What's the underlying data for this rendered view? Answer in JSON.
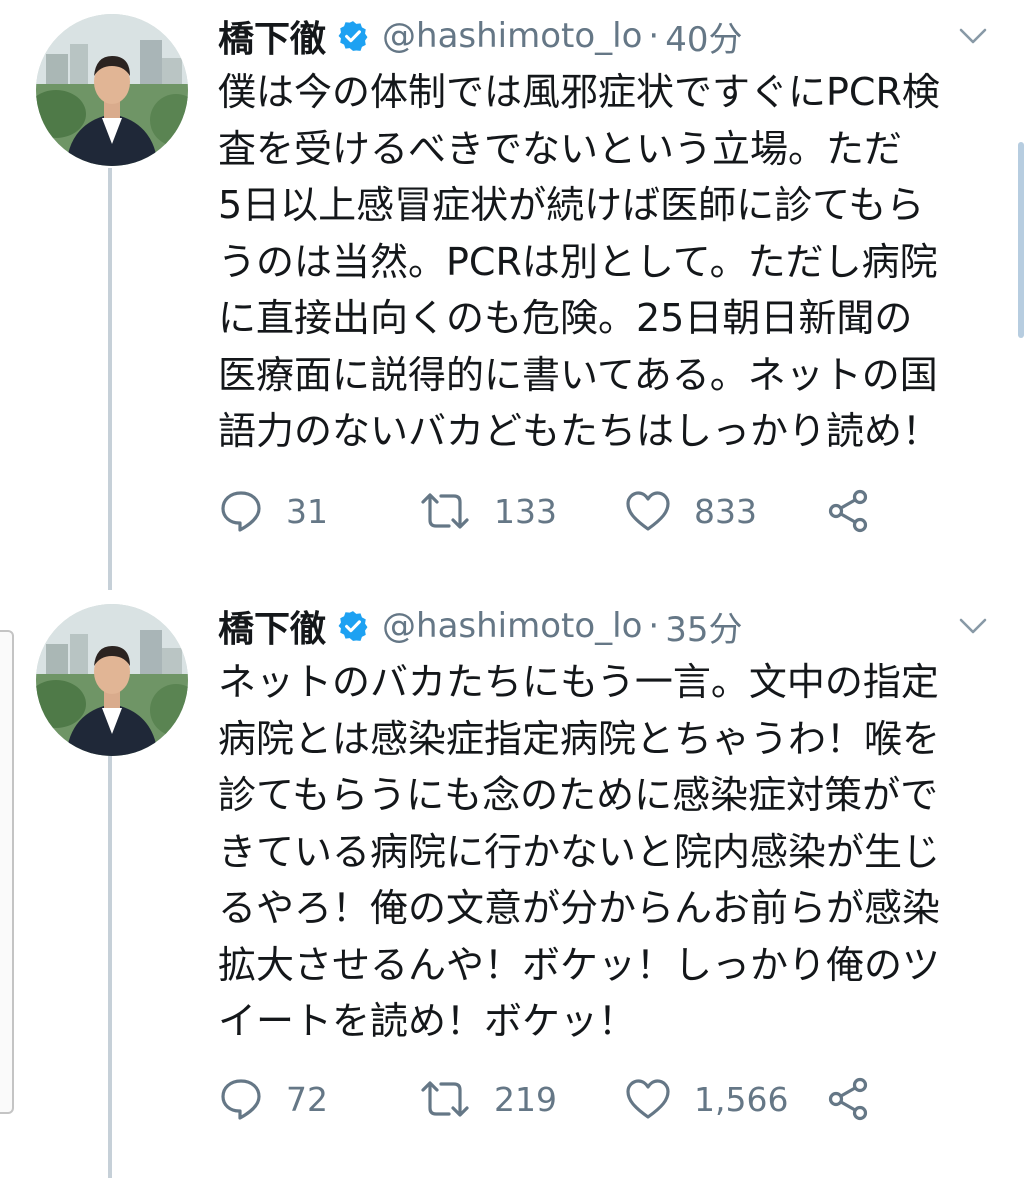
{
  "tweets": [
    {
      "author": {
        "name": "橋下徹",
        "handle": "@hashimoto_lo"
      },
      "separator": "·",
      "time": "40分",
      "body_lines": [
        "僕は今の体制では風邪症状ですぐにPCR検",
        "査を受けるべきでないという立場。ただ",
        "5日以上感冒症状が続けば医師に診てもら",
        "うのは当然。PCRは別として。ただし病院",
        "に直接出向くのも危険。25日朝日新聞の",
        "医療面に説得的に書いてある。ネットの国",
        "語力のないバカどもたちはしっかり読め！"
      ],
      "stats": {
        "replies": "31",
        "retweets": "133",
        "likes": "833"
      }
    },
    {
      "author": {
        "name": "橋下徹",
        "handle": "@hashimoto_lo"
      },
      "separator": "·",
      "time": "35分",
      "body_lines": [
        "ネットのバカたちにもう一言。文中の指定",
        "病院とは感染症指定病院とちゃうわ！喉を",
        "診てもらうにも念のために感染症対策がで",
        "きている病院に行かないと院内感染が生じ",
        "るやろ！俺の文意が分からんお前らが感染",
        "拡大させるんや！ボケッ！しっかり俺のツ",
        "イートを読め！ボケッ！"
      ],
      "stats": {
        "replies": "72",
        "retweets": "219",
        "likes": "1,566"
      }
    }
  ],
  "icons": {
    "verified": "verified-badge-icon",
    "more": "chevron-down-icon",
    "reply": "reply-bubble-icon",
    "retweet": "retweet-arrows-icon",
    "like": "heart-outline-icon",
    "share": "share-nodes-icon"
  },
  "colors": {
    "verified_blue": "#1da1f2",
    "text_primary": "#14171a",
    "text_secondary": "#657786",
    "thread_line": "#c6d0d8"
  }
}
